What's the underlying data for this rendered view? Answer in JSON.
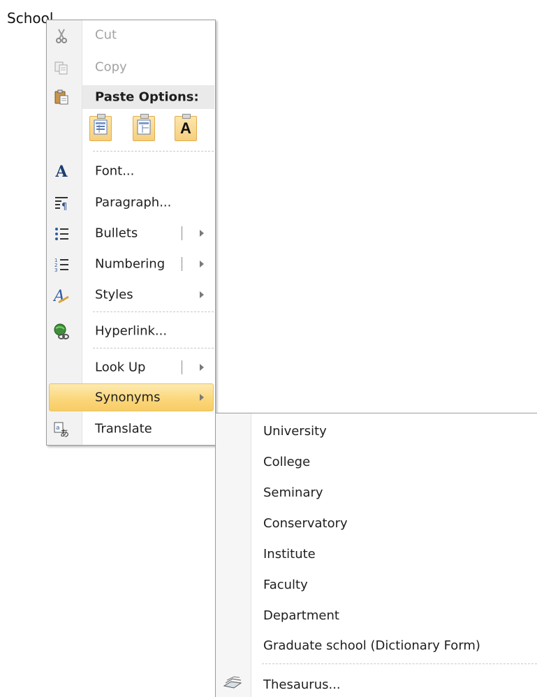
{
  "document": {
    "text": "School"
  },
  "context_menu": {
    "cut": "Cut",
    "copy": "Copy",
    "paste_options": "Paste Options:",
    "font": "Font...",
    "paragraph": "Paragraph...",
    "bullets": "Bullets",
    "numbering": "Numbering",
    "styles": "Styles",
    "hyperlink": "Hyperlink...",
    "lookup": "Look Up",
    "synonyms": "Synonyms",
    "translate": "Translate"
  },
  "synonyms_submenu": {
    "items": [
      "University",
      "College",
      "Seminary",
      "Conservatory",
      "Institute",
      "Faculty",
      "Department",
      "Graduate school (Dictionary Form)"
    ],
    "thesaurus": "Thesaurus..."
  },
  "colors": {
    "highlight": "#fbd77c",
    "highlight_border": "#e5c365",
    "gutter": "#f2f2f2",
    "disabled_text": "#a3a3a3"
  },
  "icons": [
    "scissors-icon",
    "copy-icon",
    "paste-icon",
    "paste-keep-source-icon",
    "paste-merge-icon",
    "paste-text-only-icon",
    "font-icon",
    "paragraph-icon",
    "bullets-icon",
    "numbering-icon",
    "styles-icon",
    "hyperlink-icon",
    "translate-icon",
    "thesaurus-icon"
  ]
}
